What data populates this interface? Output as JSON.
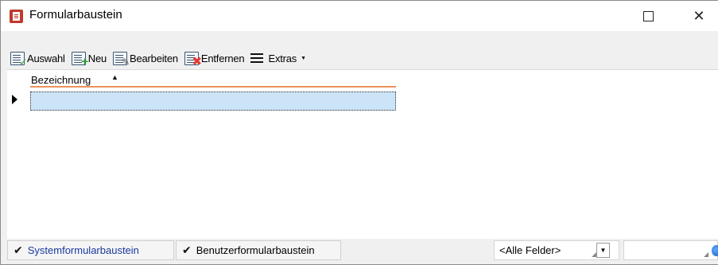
{
  "window": {
    "title": "Formularbaustein"
  },
  "toolbar": {
    "items": [
      {
        "label": "Auswahl",
        "icon": "select-list-icon"
      },
      {
        "label": "Neu",
        "icon": "new-list-icon"
      },
      {
        "label": "Bearbeiten",
        "icon": "edit-list-icon"
      },
      {
        "label": "Entfernen",
        "icon": "delete-list-icon"
      },
      {
        "label": "Extras",
        "icon": "hamburger-menu-icon"
      }
    ]
  },
  "grid": {
    "columns": [
      {
        "header": "Bezeichnung",
        "sort": "ascending"
      }
    ],
    "rows": [
      {
        "cells": [
          ""
        ],
        "selected": true
      }
    ]
  },
  "statusbar": {
    "filters": [
      {
        "label": "Systemformularbaustein",
        "checked": true
      },
      {
        "label": "Benutzerformularbaustein",
        "checked": true
      }
    ],
    "field_select": "<Alle Felder>",
    "search_value": ""
  },
  "colors": {
    "selection": "#cce4f7",
    "header_accent": "#e8935c",
    "title_icon": "#c0392b",
    "system_filter_text": "#1a3a9e"
  }
}
